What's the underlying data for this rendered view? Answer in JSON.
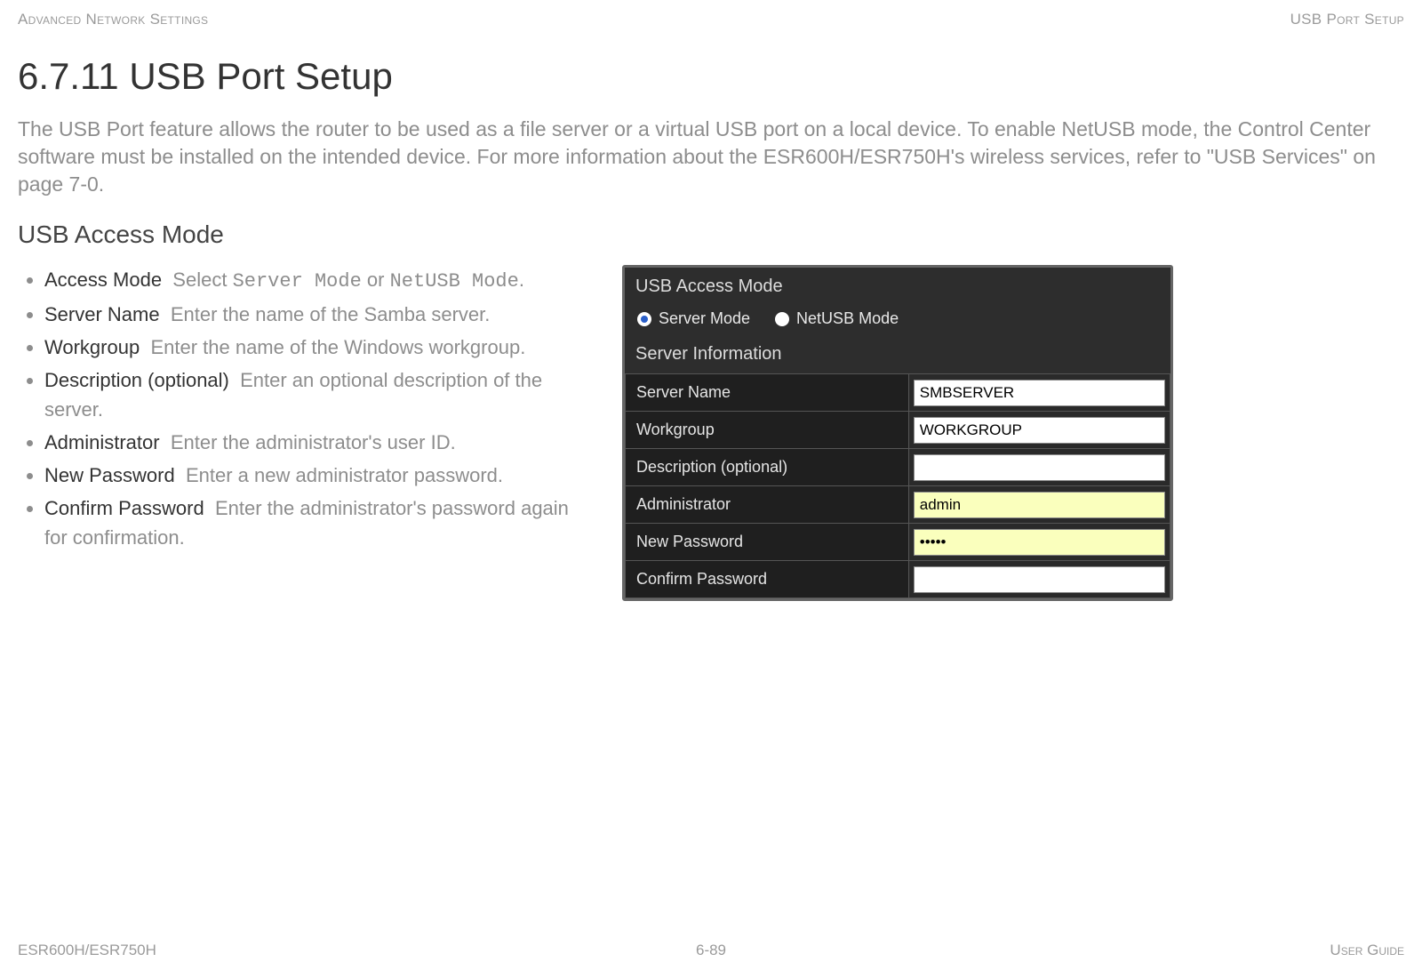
{
  "header": {
    "left": "Advanced Network Settings",
    "right": "USB Port Setup"
  },
  "title": "6.7.11 USB Port Setup",
  "intro": "The USB Port feature allows the router to be used as a file server or a virtual USB port on a local device. To enable NetUSB mode, the Control Center software must be installed on the intended device. For more information about the ESR600H/ESR750H's wireless services, refer to \"USB Services\" on page 7-0.",
  "section": "USB Access Mode",
  "bullets": [
    {
      "term": "Access Mode",
      "pre": "Select ",
      "code1": "Server Mode",
      "mid": " or ",
      "code2": "NetUSB Mode",
      "post": "."
    },
    {
      "term": "Server Name",
      "desc": "Enter the name of the Samba server."
    },
    {
      "term": "Workgroup",
      "desc": "Enter the name of the Windows workgroup."
    },
    {
      "term": "Description (optional)",
      "desc": "Enter an optional description of the server."
    },
    {
      "term": "Administrator",
      "desc": "Enter the administrator's user ID."
    },
    {
      "term": "New Password",
      "desc": "Enter a new administrator password."
    },
    {
      "term": "Confirm Password",
      "desc": "Enter the administrator's password again for confirmation."
    }
  ],
  "panel": {
    "heading": "USB Access Mode",
    "radios": {
      "server": "Server Mode",
      "netusb": "NetUSB Mode",
      "selected": "server"
    },
    "subheading": "Server Information",
    "rows": [
      {
        "label": "Server Name",
        "value": "SMBSERVER",
        "style": "white",
        "type": "text"
      },
      {
        "label": "Workgroup",
        "value": "WORKGROUP",
        "style": "white",
        "type": "text"
      },
      {
        "label": "Description (optional)",
        "value": "",
        "style": "white",
        "type": "text"
      },
      {
        "label": "Administrator",
        "value": "admin",
        "style": "yellow",
        "type": "text"
      },
      {
        "label": "New Password",
        "value": "•••••",
        "style": "yellow",
        "type": "text"
      },
      {
        "label": "Confirm Password",
        "value": "",
        "style": "white",
        "type": "text"
      }
    ]
  },
  "footer": {
    "left": "ESR600H/ESR750H",
    "center": "6-89",
    "right": "User Guide"
  }
}
